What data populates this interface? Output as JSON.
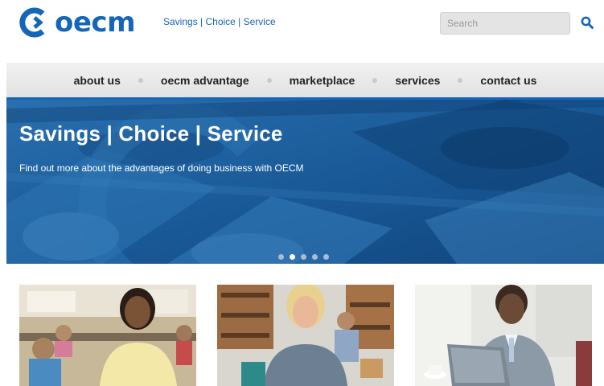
{
  "brand": {
    "name": "oecm",
    "tagline": "Savings | Choice | Service",
    "color": "#1565b8"
  },
  "search": {
    "placeholder": "Search",
    "button_icon": "search-icon"
  },
  "nav": {
    "items": [
      {
        "label": "about us"
      },
      {
        "label": "oecm advantage"
      },
      {
        "label": "marketplace"
      },
      {
        "label": "services"
      },
      {
        "label": "contact us"
      }
    ]
  },
  "hero": {
    "title": "Savings | Choice | Service",
    "subtitle": "Find out more about the advantages of doing business with OECM",
    "slide_count": 5,
    "active_slide": 2
  },
  "cards": [
    {
      "image": "woman-in-classroom-photo"
    },
    {
      "image": "woman-in-warehouse-photo"
    },
    {
      "image": "man-with-laptop-photo"
    }
  ]
}
